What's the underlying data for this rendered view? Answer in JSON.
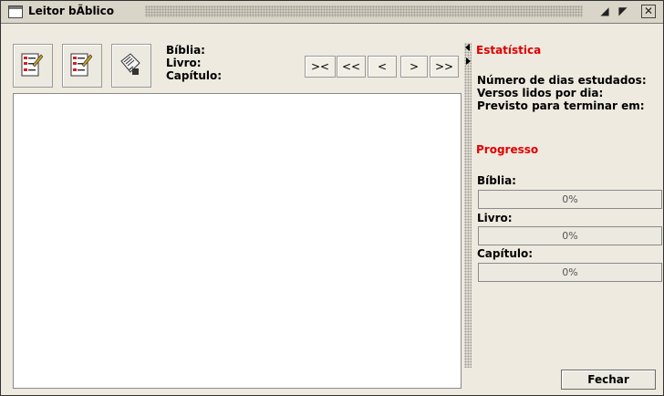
{
  "window": {
    "title": "Leitor bÃ­blico"
  },
  "toolbar": {
    "buttons": [
      {
        "icon": "edit-list-icon"
      },
      {
        "icon": "edit-checklist-icon"
      },
      {
        "icon": "clipboard-pen-icon"
      }
    ]
  },
  "location_labels": {
    "biblia": "Bíblia:",
    "livro": "Livro:",
    "capitulo": "Capítulo:"
  },
  "nav": {
    "shrink": "><",
    "first": "<<",
    "prev": "<",
    "next": ">",
    "last": ">>"
  },
  "stats": {
    "title": "Estatística",
    "dias": "Número de dias estudados:",
    "versos": "Versos lidos por dia:",
    "previsto": "Previsto para terminar em:"
  },
  "progress": {
    "title": "Progresso",
    "items": [
      {
        "label": "Bíblia:",
        "value_text": "0%",
        "fraction": 0
      },
      {
        "label": "Livro:",
        "value_text": "0%",
        "fraction": 0
      },
      {
        "label": "Capítulo:",
        "value_text": "0%",
        "fraction": 0
      }
    ]
  },
  "footer": {
    "close_label": "Fechar"
  },
  "colors": {
    "accent_red": "#e00000",
    "panel_bg": "#eeeae0"
  }
}
